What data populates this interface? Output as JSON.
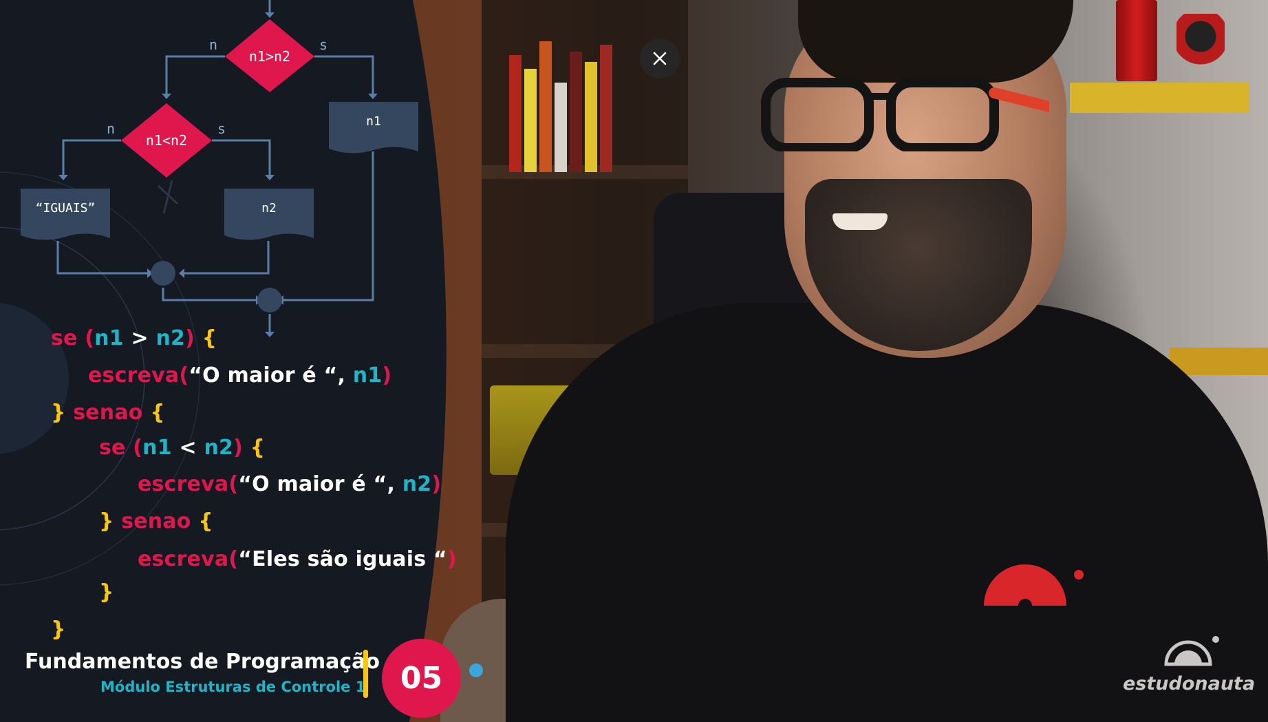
{
  "player": {
    "close_icon": "close-icon"
  },
  "flowchart": {
    "decision_1": "n1>n2",
    "decision_2": "n1<n2",
    "label_no": "n",
    "label_yes": "s",
    "output_n1": "n1",
    "output_n2": "n2",
    "output_equal": "“IGUAIS”"
  },
  "code": {
    "lines": [
      [
        "se ",
        "(",
        "n1",
        " > ",
        "n2",
        ")",
        " {"
      ],
      [
        "escreva",
        "(",
        "“O maior é “, ",
        "n1",
        ")"
      ],
      [
        "}",
        " senao ",
        "{"
      ],
      [
        "se ",
        "(",
        "n1",
        " < ",
        "n2",
        ")",
        " {"
      ],
      [
        "escreva",
        "(",
        "“O maior é “, ",
        "n2",
        ")"
      ],
      [
        "}",
        " senao ",
        "{"
      ],
      [
        "escreva",
        "(",
        "“Eles são iguais “",
        ")"
      ],
      [
        "}"
      ],
      [
        "}"
      ]
    ]
  },
  "course": {
    "title": "Fundamentos de Programação",
    "subtitle": "Módulo Estruturas de Controle 1",
    "episode": "05"
  },
  "brand": {
    "wordmark": "estudonauta"
  },
  "colors": {
    "keyword": "#e0174d",
    "brace": "#f5c518",
    "variable": "#1fb5c9",
    "panel": "#141922",
    "flow_box": "#34475f",
    "flow_line": "#5a7ea8"
  }
}
